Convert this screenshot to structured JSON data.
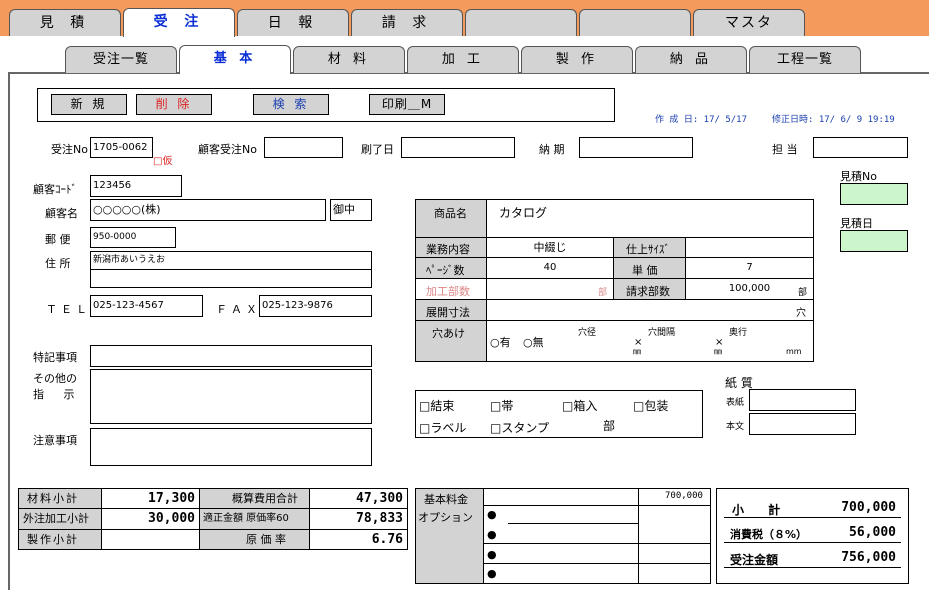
{
  "top_tabs": [
    "見 積",
    "受 注",
    "日 報",
    "請 求",
    "",
    "",
    "マスタ"
  ],
  "sub_tabs": [
    "受注一覧",
    "基 本",
    "材 料",
    "加 工",
    "製 作",
    "納 品",
    "工程一覧"
  ],
  "buttons": {
    "new": "新 規",
    "delete": "削 除",
    "search": "検 索",
    "print": "印刷＿M"
  },
  "dates": {
    "created": "作 成 日: 17/ 5/17",
    "modified": "修正日時: 17/ 6/ 9 19:19"
  },
  "order": {
    "no_label": "受注No",
    "no_value": "1705-0062",
    "provisional": "□仮",
    "client_order_label": "顧客受注No",
    "print_end_label": "刷了日",
    "delivery_label": "納 期",
    "person_label": "担 当",
    "estimate_no_label": "見積No",
    "estimate_date_label": "見積日"
  },
  "customer": {
    "code_label": "顧客ｺｰﾄﾞ",
    "code_value": "123456",
    "name_label": "顧客名",
    "name_value": "○○○○○(株)",
    "honorific": "御中",
    "postal_label": "郵 便",
    "postal_value": "950-0000",
    "address_label": "住 所",
    "address_value": "新潟市あいうえお",
    "tel_label": "ＴＥＬ",
    "tel_value": "025-123-4567",
    "fax_label": "ＦＡＸ",
    "fax_value": "025-123-9876"
  },
  "notes": {
    "special": "特記事項",
    "other_1": "その他の",
    "other_2": "指 示",
    "caution": "注意事項"
  },
  "product": {
    "name_label": "商品名",
    "name_value": "カタログ",
    "work_label": "業務内容",
    "work_value": "中綴じ",
    "size_label": "仕上ｻｲｽﾞ",
    "pages_label": "ﾍﾟｰｼﾞ数",
    "pages_value": "40",
    "unit_price_label": "単 価",
    "unit_price_value": "7",
    "proc_count_label": "加工部数",
    "proc_count_unit": "部",
    "bill_count_label": "請求部数",
    "bill_count_value": "100,000",
    "bill_count_unit": "部",
    "unfold_label": "展開寸法",
    "unfold_unit": "穴",
    "hole_label": "穴あけ",
    "hole_yes": "○有",
    "hole_no": "○無",
    "hole_dia": "穴径",
    "hole_gap": "穴間隔",
    "hole_depth": "奥行",
    "mm": "㎜",
    "mm2": "mm"
  },
  "finishing": {
    "items": [
      "□結束",
      "□帯",
      "□箱入",
      "□包装",
      "□ラベル",
      "□スタンプ"
    ],
    "unit": "部"
  },
  "paper": {
    "title": "紙 質",
    "cover": "表紙",
    "body": "本文"
  },
  "summary": {
    "material_label": "材料小計",
    "material_value": "17,300",
    "outsource_label": "外注加工小計",
    "outsource_value": "30,000",
    "production_label": "製作小計",
    "est_cost_label": "概算費用合計",
    "est_cost_value": "47,300",
    "fair_label": "適正金額 原価率60",
    "fair_value": "78,833",
    "cost_rate_label": "原 価 率",
    "cost_rate_value": "6.76"
  },
  "base_fee": {
    "label_1": "基本料金",
    "label_2": "オプション",
    "value": "700,000",
    "bullet": "●"
  },
  "totals": {
    "subtotal_label": "小 計",
    "subtotal_value": "700,000",
    "tax_label": "消費税（８%）",
    "tax_value": "56,000",
    "total_label": "受注金額",
    "total_value": "756,000"
  }
}
